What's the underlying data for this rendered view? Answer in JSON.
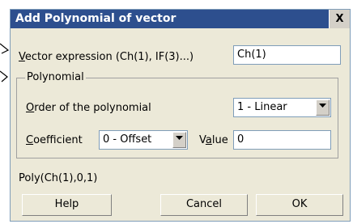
{
  "dialog": {
    "title": "Add Polynomial of vector",
    "close_label": "X"
  },
  "vector_expression": {
    "label_key": "V",
    "label_rest": "ector expression (Ch(1), IF(3)...)",
    "value": "Ch(1)"
  },
  "polynomial_group": {
    "title": "Polynomial",
    "order": {
      "label_key": "O",
      "label_rest": "rder of the polynomial",
      "selected": "1 - Linear"
    },
    "coefficient": {
      "label_key": "C",
      "label_rest": "oefficient",
      "selected": "0 - Offset"
    },
    "value": {
      "label_pre": "V",
      "label_key": "a",
      "label_rest": "lue",
      "value": "0"
    }
  },
  "result_expression": "Poly(Ch(1),0,1)",
  "buttons": {
    "help": "Help",
    "cancel": "Cancel",
    "ok": "OK"
  }
}
